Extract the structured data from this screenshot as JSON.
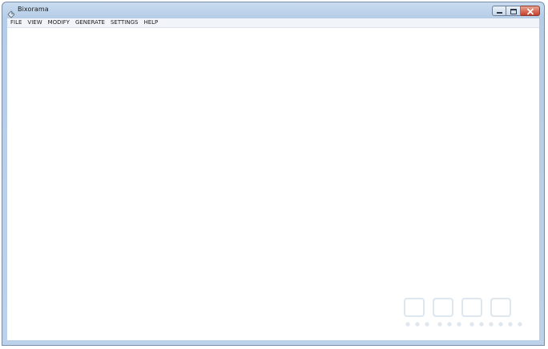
{
  "window": {
    "title": "Bixorama"
  },
  "menu": {
    "items": [
      {
        "label": "FILE"
      },
      {
        "label": "VIEW"
      },
      {
        "label": "MODIFY"
      },
      {
        "label": "GENERATE"
      },
      {
        "label": "SETTINGS"
      },
      {
        "label": "HELP"
      }
    ]
  },
  "icons": {
    "app": "bixorama-app-icon",
    "minimize": "minimize-icon",
    "maximize": "maximize-icon",
    "close": "close-icon"
  },
  "colors": {
    "title_bar": "#bcd2ea",
    "close_button": "#c7402a",
    "client_background": "#ffffff"
  }
}
